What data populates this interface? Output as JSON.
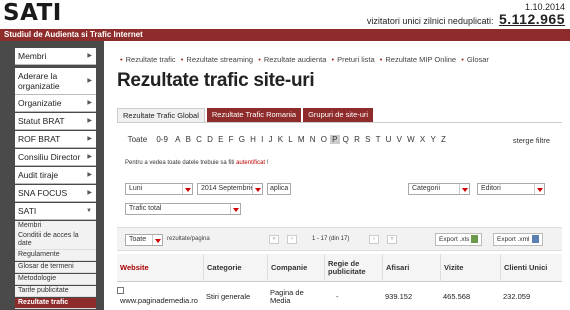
{
  "header": {
    "logo": "SATI",
    "date": "1.10.2014",
    "visitors_label": "vizitatori unici zilnici neduplicati:",
    "visitors_count": "5.112.965",
    "banner": "Studiul de Audienta si Trafic Internet"
  },
  "sidebar": {
    "items": [
      {
        "label": "Membri"
      },
      {
        "label": "Aderare la organizatie"
      },
      {
        "label": "Organizatie"
      },
      {
        "label": "Statut BRAT"
      },
      {
        "label": "ROF BRAT"
      },
      {
        "label": "Consiliu Director"
      },
      {
        "label": "Audit tiraje"
      },
      {
        "label": "SNA FOCUS"
      },
      {
        "label": "SATI"
      }
    ],
    "sub_items": [
      {
        "label": "Membri"
      },
      {
        "label": "Conditii de acces la date"
      },
      {
        "label": "Regulamente"
      },
      {
        "label": "Glosar de termeni"
      },
      {
        "label": "Metodologie"
      },
      {
        "label": "Tarife publicitate"
      },
      {
        "label": "Rezultate trafic"
      }
    ]
  },
  "breadcrumbs": [
    "Rezultate trafic",
    "Rezultate streaming",
    "Rezultate audienta",
    "Preturi lista",
    "Rezultate MIP Online",
    "Glosar"
  ],
  "page_title": "Rezultate trafic site-uri",
  "tabs": [
    "Rezultate Trafic Global",
    "Rezultate Trafic Romania",
    "Grupuri de site-uri"
  ],
  "alphabet": [
    "Toate",
    "0-9",
    "A",
    "B",
    "C",
    "D",
    "E",
    "F",
    "G",
    "H",
    "I",
    "J",
    "K",
    "L",
    "M",
    "N",
    "O",
    "P",
    "Q",
    "R",
    "S",
    "T",
    "U",
    "V",
    "W",
    "X",
    "Y",
    "Z"
  ],
  "alphabet_selected": "P",
  "clear_filters": "sterge filtre",
  "note": {
    "text": "Pentru a vedea toate datele trebuie sa fiti ",
    "link": "autentificat",
    "end": " !"
  },
  "filters": {
    "period": "Luni",
    "month": "2014 Septembrie",
    "apply": "aplica",
    "category": "Categorii",
    "publisher": "Editori",
    "traffic": "Trafic total"
  },
  "pager": {
    "per_page": "Toate",
    "per_page_label": "rezultate/pagina",
    "range": "1 - 17 (din 17)",
    "export_xls": "Export .xls",
    "export_xml": "Export .xml"
  },
  "table": {
    "columns": [
      "Website",
      "Categorie",
      "Companie",
      "Regie de publicitate",
      "Afisari",
      "Vizite",
      "Clienti Unici"
    ],
    "rows": [
      {
        "website": "www.paginademedia.ro",
        "categorie": "Stiri generale",
        "companie": "Pagina de Media",
        "regie": "-",
        "afisari": "939.152",
        "vizite": "465.568",
        "clienti": "232.059"
      }
    ]
  }
}
